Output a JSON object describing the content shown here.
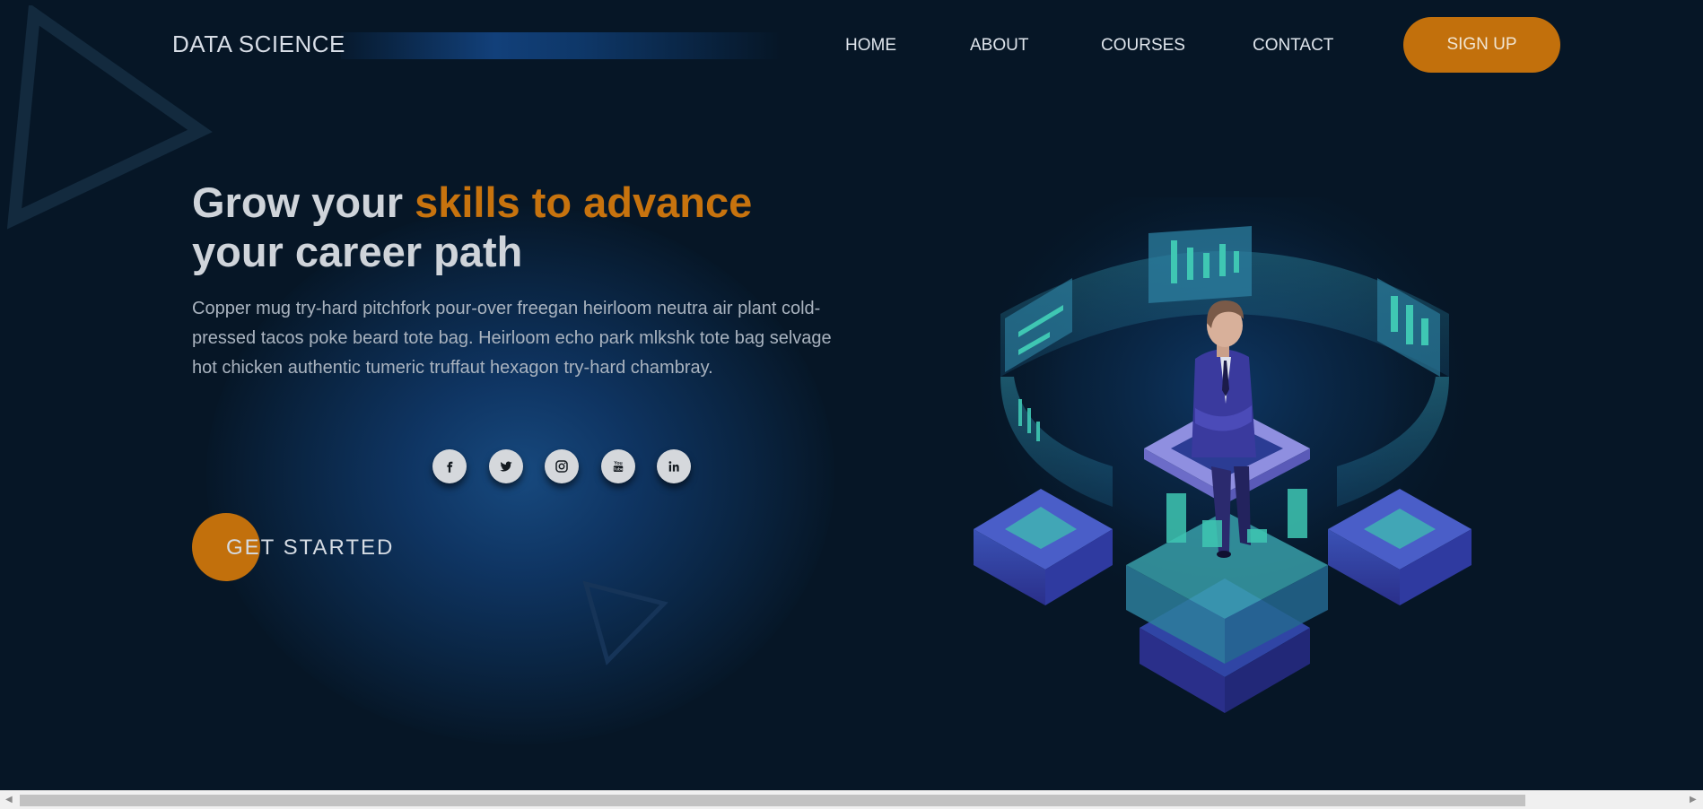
{
  "header": {
    "logo": "DATA SCIENCE",
    "nav": [
      "HOME",
      "ABOUT",
      "COURSES",
      "CONTACT"
    ],
    "signup_label": "SIGN UP"
  },
  "hero": {
    "headline_part1": "Grow your ",
    "headline_accent": "skills to advance",
    "headline_part2": "your career path",
    "description": "Copper mug try-hard pitchfork pour-over freegan heirloom neutra air plant cold-pressed tacos poke beard tote bag. Heirloom echo park mlkshk tote bag selvage hot chicken authentic tumeric truffaut hexagon try-hard chambray.",
    "social_icons": [
      "facebook-icon",
      "twitter-icon",
      "instagram-icon",
      "youtube-icon",
      "linkedin-icon"
    ],
    "cta_label": "GET STARTED"
  },
  "colors": {
    "background": "#061626",
    "accent": "#c2700c",
    "text": "#cfd4da"
  },
  "illustration": {
    "icon": "data-analyst-isometric-illustration"
  }
}
